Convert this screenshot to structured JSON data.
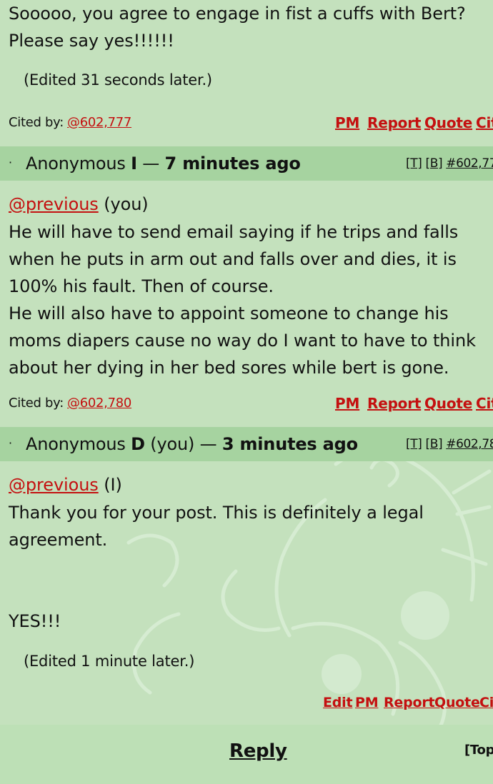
{
  "post1": {
    "lines": [
      "Sooooo, you agree to engage in fist a cuffs with Bert?",
      "Please say yes!!!!!!"
    ],
    "edited": "(Edited 31 seconds later.)",
    "cited_by_label": "Cited by:",
    "cited_by_link": "@602,777",
    "actions": [
      "PM",
      "Report",
      "Quote",
      "Cit"
    ]
  },
  "post2": {
    "header": {
      "dot": "·",
      "prefix": "Anonymous ",
      "id": "I",
      "you": "",
      "dash": " — ",
      "time": "7 minutes ago",
      "t_link": "[T]",
      "b_link": "[B]",
      "number": "#602,77"
    },
    "mention": "@previous",
    "mention_suffix": " (you)",
    "lines": [
      "He will have to send email saying if he trips and falls",
      "when he puts in arm out and falls over and dies, it is",
      "100% his fault. Then of course.",
      "He will also have to appoint someone to change his",
      "moms diapers cause no way do I want to have to think",
      "about her dying in her bed sores while bert is gone."
    ],
    "cited_by_label": "Cited by:",
    "cited_by_link": "@602,780",
    "actions": [
      "PM",
      "Report",
      "Quote",
      "Cit"
    ]
  },
  "post3": {
    "header": {
      "dot": "·",
      "prefix": "Anonymous ",
      "id": "D",
      "you": " (you)",
      "dash": " — ",
      "time": "3 minutes ago",
      "t_link": "[T]",
      "b_link": "[B]",
      "number": "#602,78"
    },
    "mention": "@previous",
    "mention_suffix": " (I)",
    "lines": [
      "Thank you for your post. This is definitely a legal",
      "agreement.",
      "YES!!!"
    ],
    "edited": "(Edited 1 minute later.)",
    "actions": [
      "Edit",
      "PM",
      "Report",
      "Quote",
      "Ci"
    ]
  },
  "footer": {
    "reply": "Reply",
    "top": "[Top"
  },
  "colors": {
    "background": "#c4e1bd",
    "header": "#a6d3a0",
    "link_red": "#c41010"
  }
}
